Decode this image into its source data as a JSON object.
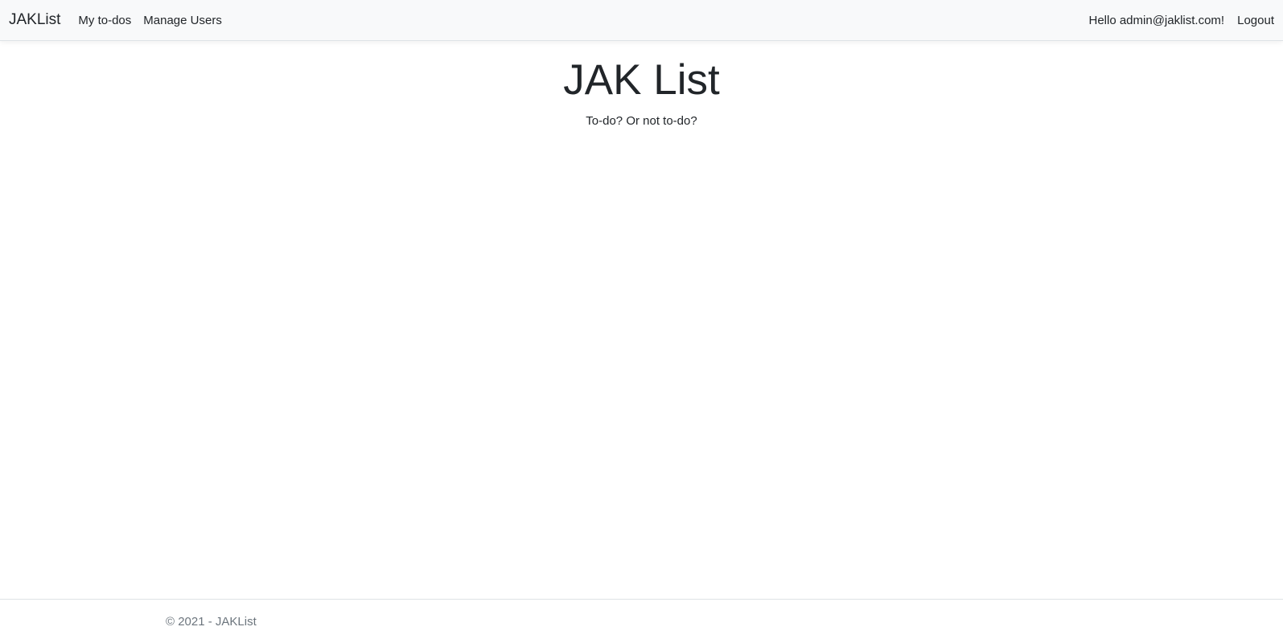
{
  "navbar": {
    "brand": "JAKList",
    "links": [
      {
        "label": "My to-dos"
      },
      {
        "label": "Manage Users"
      }
    ],
    "greeting": "Hello admin@jaklist.com!",
    "logout_label": "Logout"
  },
  "main": {
    "title": "JAK List",
    "tagline": "To-do? Or not to-do?"
  },
  "footer": {
    "text": "© 2021 - JAKList"
  },
  "colors": {
    "navbar_bg": "#f8f9fa",
    "text": "#212529",
    "muted": "#6c757d",
    "border": "#dee2e6"
  }
}
